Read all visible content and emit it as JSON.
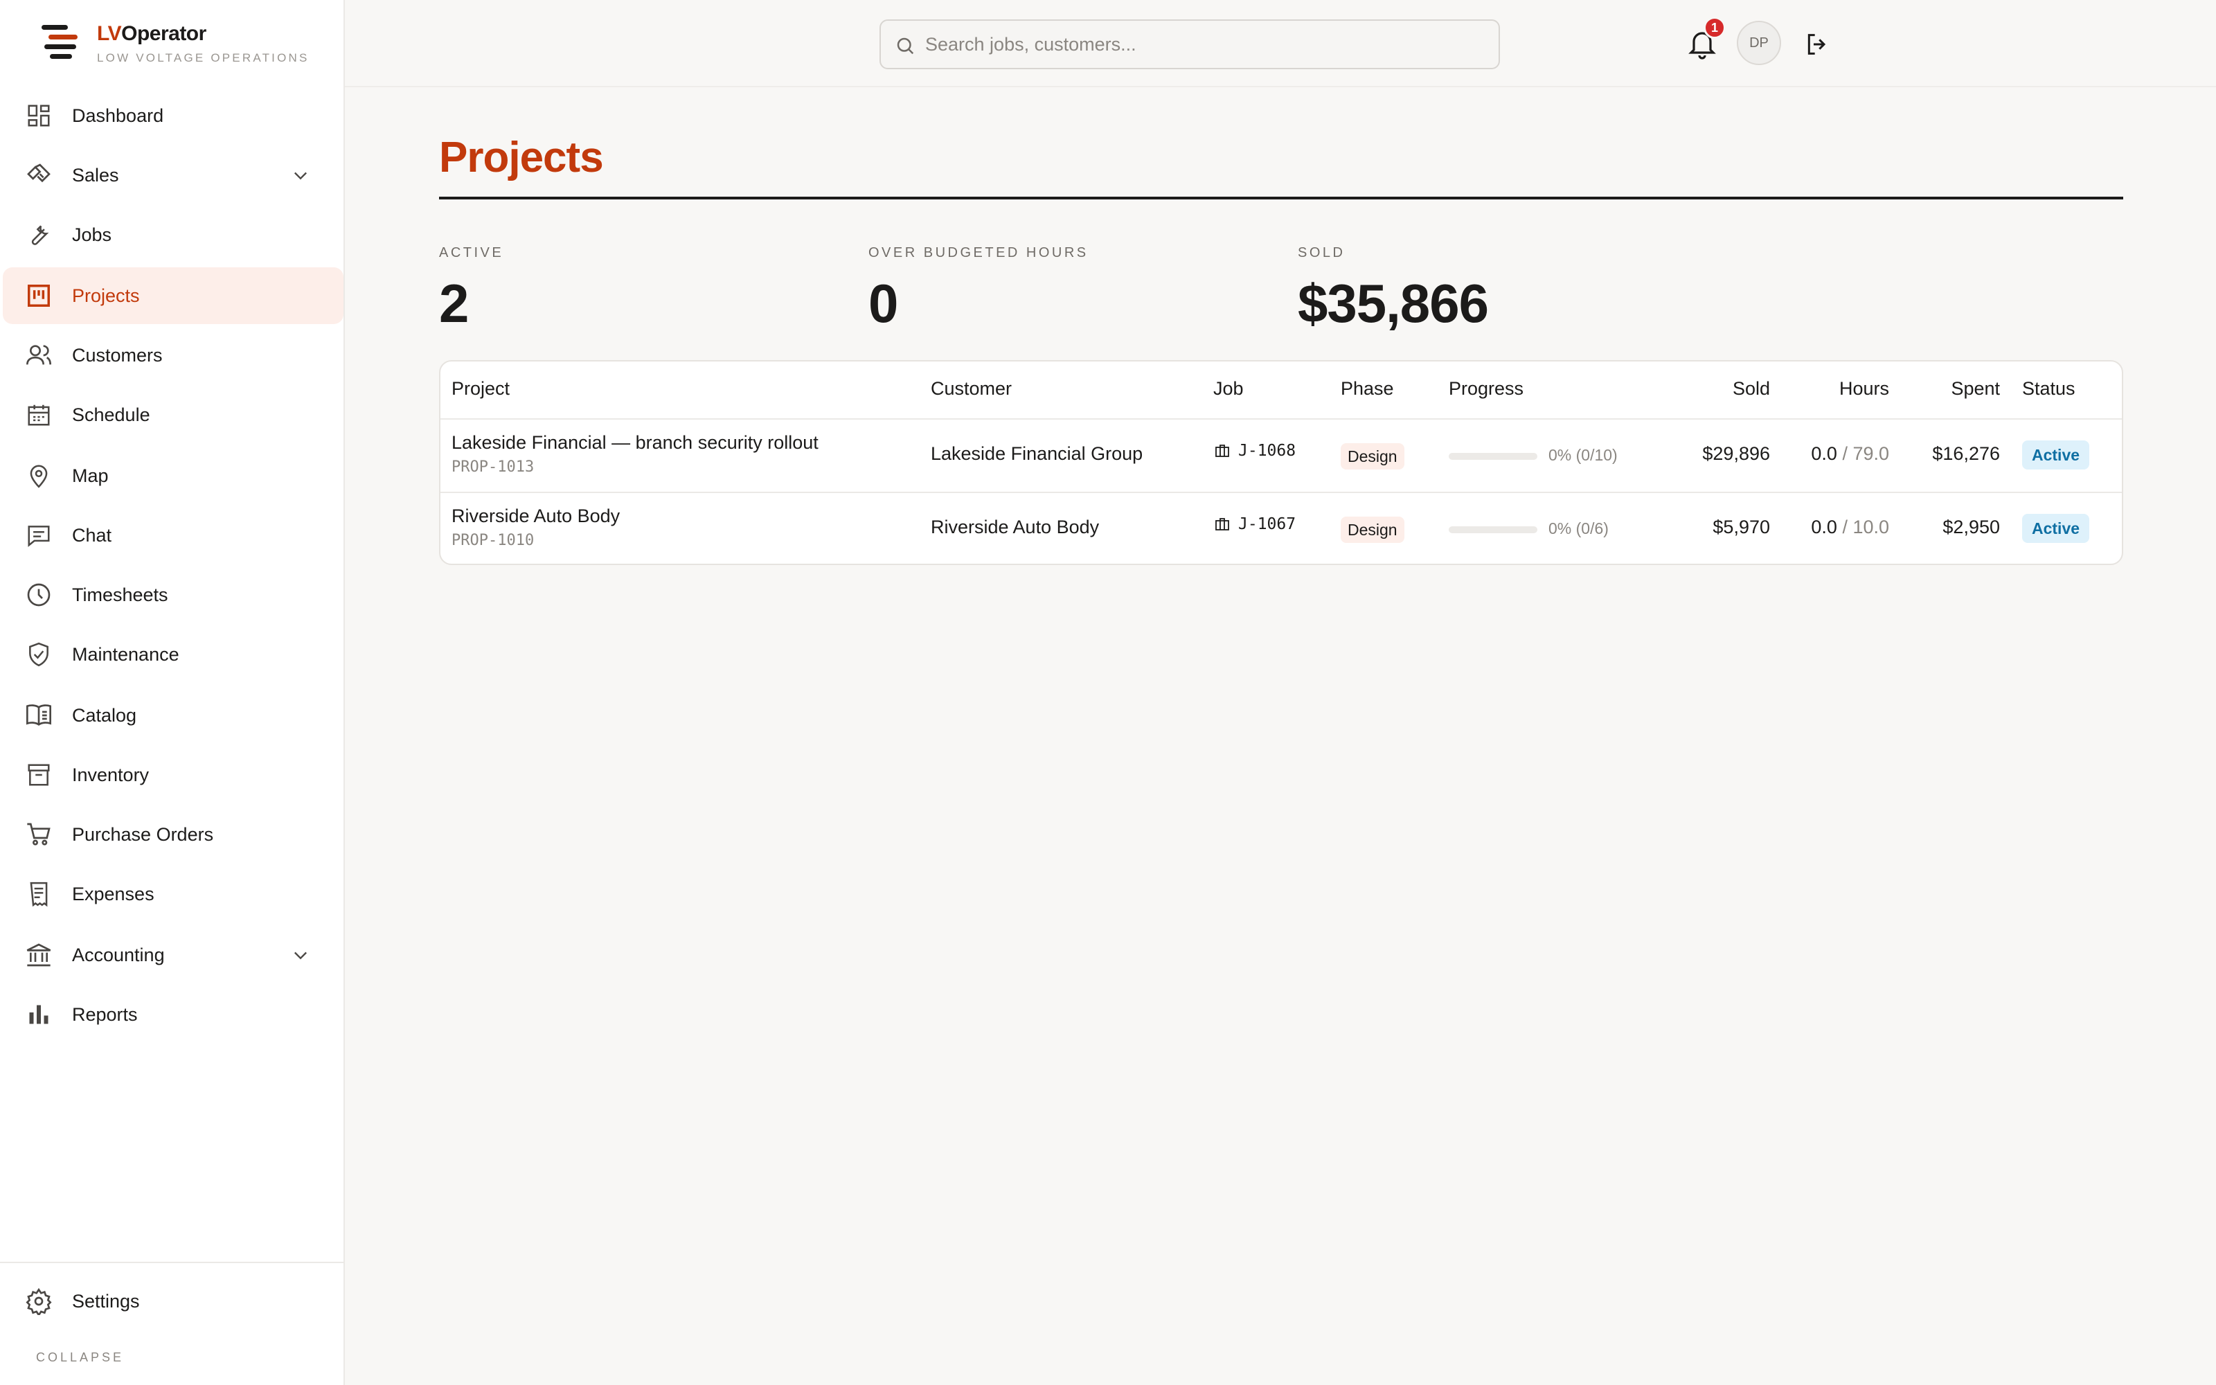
{
  "app": {
    "brand_prefix": "LV",
    "brand_suffix": "Operator",
    "tagline": "LOW VOLTAGE OPERATIONS",
    "accent_color": "#c23a0c"
  },
  "sidebar": {
    "items": [
      {
        "label": "Dashboard",
        "icon": "dashboard-icon"
      },
      {
        "label": "Sales",
        "icon": "handshake-icon",
        "expandable": true
      },
      {
        "label": "Jobs",
        "icon": "wrench-icon"
      },
      {
        "label": "Projects",
        "icon": "kanban-icon",
        "active": true
      },
      {
        "label": "Customers",
        "icon": "users-icon"
      },
      {
        "label": "Schedule",
        "icon": "calendar-icon"
      },
      {
        "label": "Map",
        "icon": "map-pin-icon"
      },
      {
        "label": "Chat",
        "icon": "chat-icon"
      },
      {
        "label": "Timesheets",
        "icon": "clock-icon"
      },
      {
        "label": "Maintenance",
        "icon": "shield-check-icon"
      },
      {
        "label": "Catalog",
        "icon": "book-icon"
      },
      {
        "label": "Inventory",
        "icon": "archive-icon"
      },
      {
        "label": "Purchase Orders",
        "icon": "cart-icon"
      },
      {
        "label": "Expenses",
        "icon": "receipt-icon"
      },
      {
        "label": "Accounting",
        "icon": "bank-icon",
        "expandable": true
      },
      {
        "label": "Reports",
        "icon": "bar-chart-icon"
      }
    ],
    "settings_label": "Settings",
    "collapse_label": "COLLAPSE"
  },
  "topbar": {
    "search_placeholder": "Search jobs, customers...",
    "notification_count": "1",
    "user_initials": "DP"
  },
  "main": {
    "title": "Projects",
    "stats": [
      {
        "label": "ACTIVE",
        "value": "2"
      },
      {
        "label": "OVER BUDGETED HOURS",
        "value": "0"
      },
      {
        "label": "SOLD",
        "value": "$35,866"
      }
    ],
    "table": {
      "headers": {
        "project": "Project",
        "customer": "Customer",
        "job": "Job",
        "phase": "Phase",
        "progress": "Progress",
        "sold": "Sold",
        "hours": "Hours",
        "spent": "Spent",
        "status": "Status"
      },
      "rows": [
        {
          "name": "Lakeside Financial — branch security rollout",
          "code": "PROP-1013",
          "customer": "Lakeside Financial Group",
          "job": "J-1068",
          "phase": "Design",
          "progress_fraction": 0,
          "progress_text": "0% (0/10)",
          "sold": "$29,896",
          "hours_used": "0.0",
          "hours_budget": "/ 79.0",
          "spent": "$16,276",
          "status": "Active"
        },
        {
          "name": "Riverside Auto Body",
          "code": "PROP-1010",
          "customer": "Riverside Auto Body",
          "job": "J-1067",
          "phase": "Design",
          "progress_fraction": 0,
          "progress_text": "0% (0/6)",
          "sold": "$5,970",
          "hours_used": "0.0",
          "hours_budget": "/ 10.0",
          "spent": "$2,950",
          "status": "Active"
        }
      ]
    }
  }
}
